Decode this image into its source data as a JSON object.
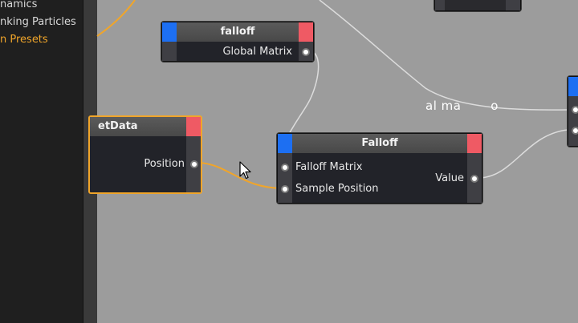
{
  "sidebar": {
    "items": [
      {
        "label": "namics"
      },
      {
        "label": "nking Particles"
      },
      {
        "label": "n Presets"
      }
    ]
  },
  "nodes": {
    "falloff_small": {
      "title": "falloff",
      "output": "Global Matrix"
    },
    "getdata": {
      "title": "etData",
      "output": "Position"
    },
    "falloff_main": {
      "title": "Falloff",
      "inputs": [
        "Falloff Matrix",
        "Sample Position"
      ],
      "output": "Value"
    }
  },
  "overlay": {
    "text": "al ma       o"
  },
  "colors": {
    "canvas_bg": "#9c9c9c",
    "node_body": "#222329",
    "header": "#505050",
    "port_blue": "#1d6ff2",
    "port_red": "#ef5a64",
    "selection": "#f0a52a",
    "wire": "#d8d8d8"
  },
  "icons": {
    "cursor": "arrow-cursor"
  }
}
